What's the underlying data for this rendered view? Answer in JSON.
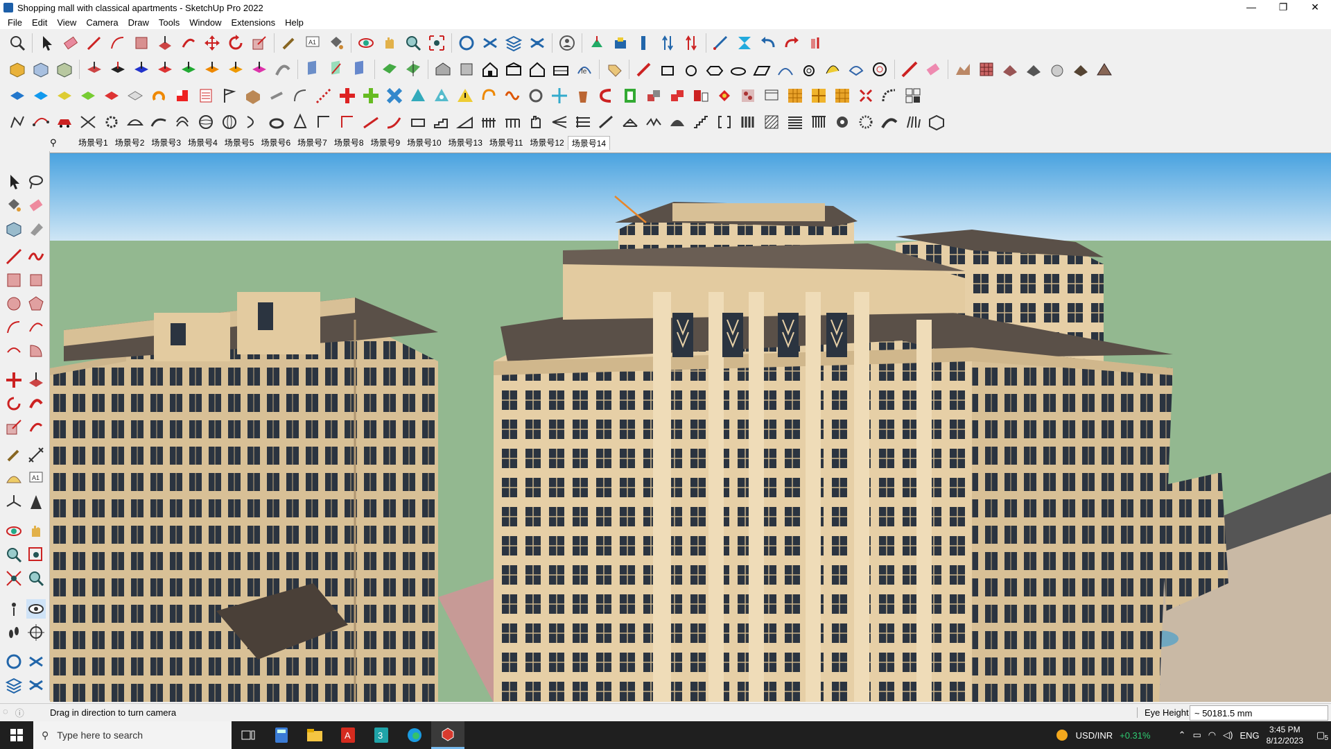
{
  "window": {
    "title": "Shopping mall with classical apartments - SketchUp Pro 2022",
    "controls": [
      "—",
      "❐",
      "✕"
    ]
  },
  "menu": [
    "File",
    "Edit",
    "View",
    "Camera",
    "Draw",
    "Tools",
    "Window",
    "Extensions",
    "Help"
  ],
  "scenes": {
    "tabs": [
      "场景号1",
      "场景号2",
      "场景号3",
      "场景号4",
      "场景号5",
      "场景号6",
      "场景号7",
      "场景号8",
      "场景号9",
      "场景号10",
      "场景号13",
      "场景号11",
      "场景号12",
      "场景号14"
    ],
    "active": "场景号14"
  },
  "status": {
    "hint": "Drag in direction to turn camera",
    "measure_label": "Eye Height",
    "measure_value": "~ 50181.5 mm"
  },
  "taskbar": {
    "search_placeholder": "Type here to search",
    "ticker_label": "USD/INR",
    "ticker_change": "+0.31%",
    "lang": "ENG",
    "time": "3:45 PM",
    "date": "8/12/2023",
    "notification_count": "5"
  },
  "colors": {
    "sky_top": "#4aa3e0",
    "sky_bottom": "#cfe6f5",
    "ground": "#93b890",
    "facade": "#e6cfa6",
    "window": "#2b3440",
    "roof": "#5a5048",
    "ticker_up": "#2ecc71"
  }
}
